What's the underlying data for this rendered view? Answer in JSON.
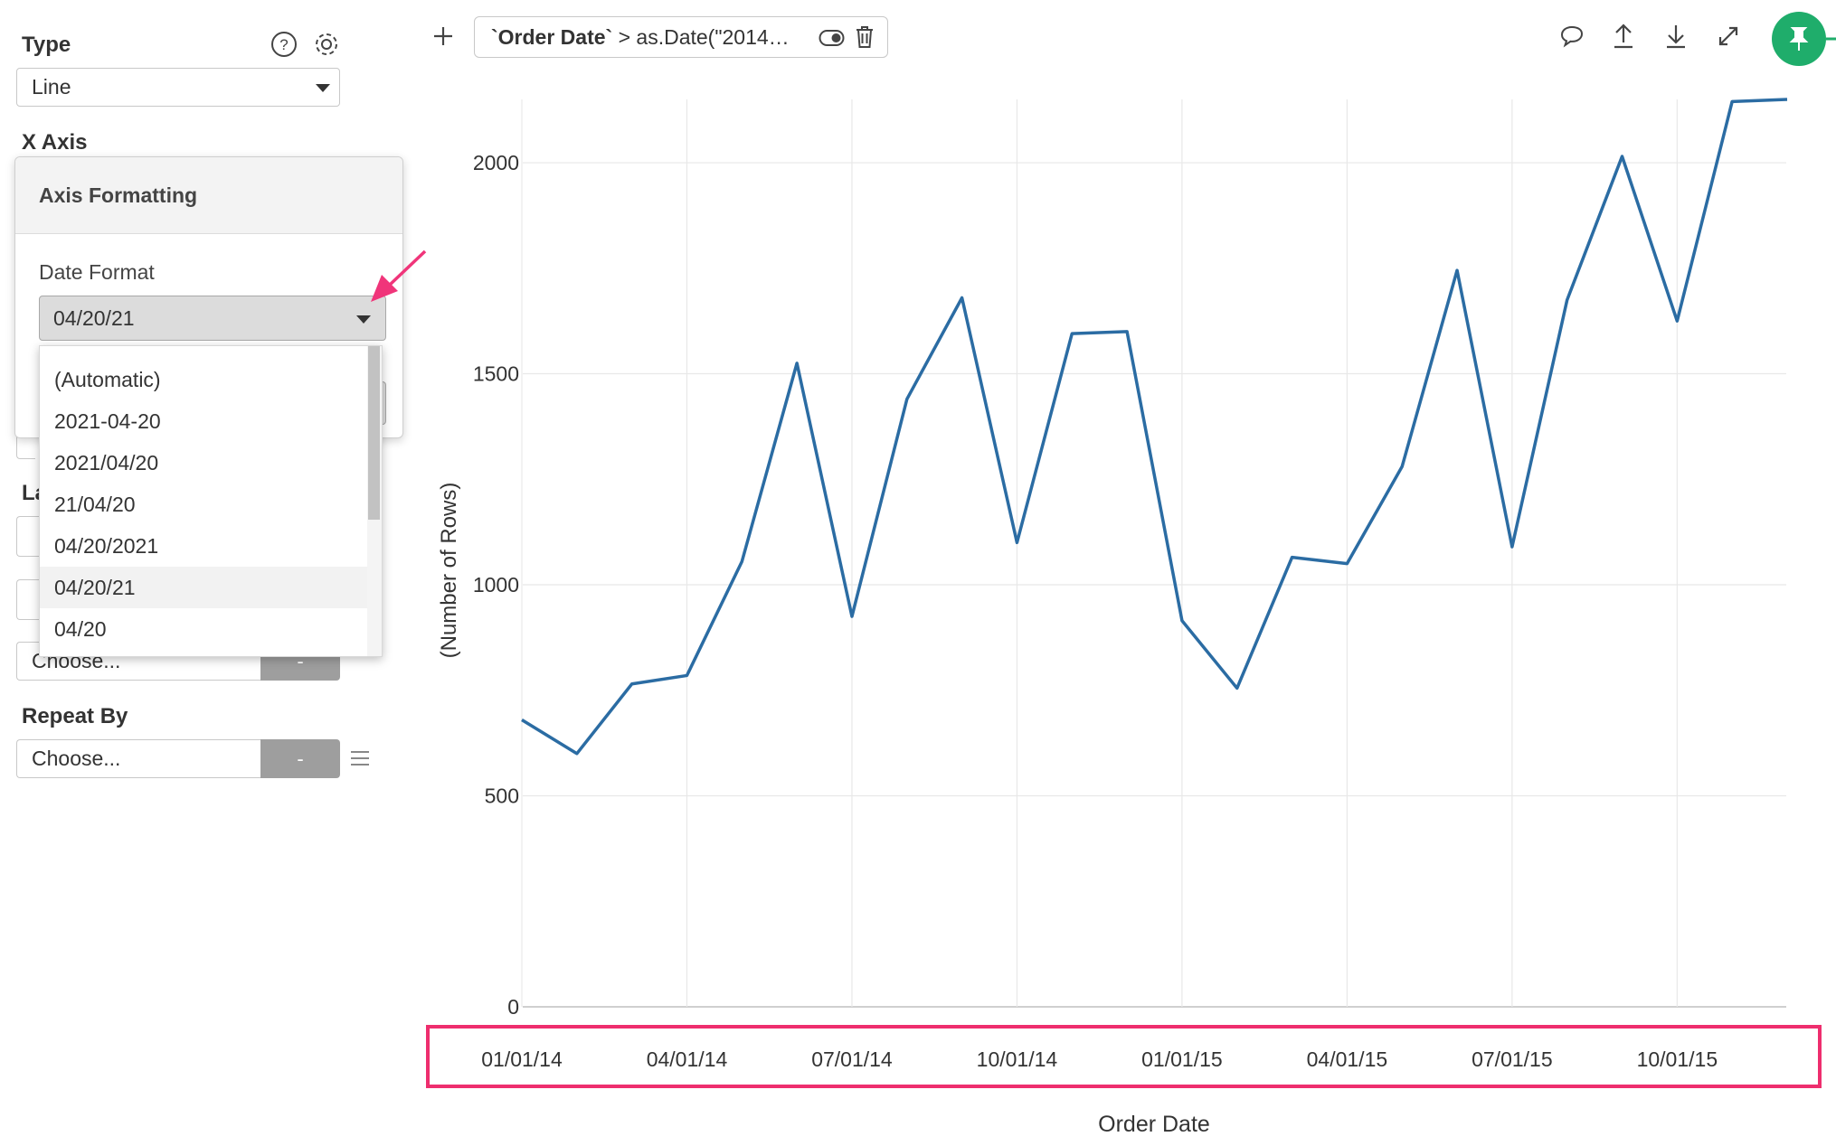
{
  "left_panel": {
    "type_label": "Type",
    "type_value": "Line",
    "x_axis_label": "X Axis",
    "partial_label": "La",
    "choose_placeholder": "Choose...",
    "choose_button": "-",
    "repeat_by_label": "Repeat By",
    "repeat_by_placeholder": "Choose...",
    "repeat_by_button": "-"
  },
  "axis_formatting": {
    "title": "Axis Formatting",
    "date_format_label": "Date Format",
    "date_format_value": "04/20/21",
    "options": [
      "(Automatic)",
      "2021-04-20",
      "2021/04/20",
      "21/04/20",
      "04/20/2021",
      "04/20/21",
      "04/20"
    ],
    "selected_index": 5
  },
  "toolbar": {
    "add_symbol": "+",
    "filter_field": "`Order Date`",
    "filter_rest": " > as.Date(\"2014…"
  },
  "icons": [
    "help-icon",
    "gear-icon",
    "add-icon",
    "toggle-icon",
    "trash-icon",
    "comment-icon",
    "upload-icon",
    "download-icon",
    "expand-icon",
    "pin-icon",
    "arrow-annotation-icon"
  ],
  "colors": {
    "line": "#2b6ca3",
    "highlight": "#ee2e6e",
    "pin": "#1fad6b",
    "arrow": "#f0357a"
  },
  "chart_data": {
    "type": "line",
    "xlabel": "Order Date",
    "ylabel": "(Number of Rows)",
    "ylim": [
      0,
      2150
    ],
    "yticks": [
      0,
      500,
      1000,
      1500,
      2000
    ],
    "xticks": [
      "01/01/14",
      "04/01/14",
      "07/01/14",
      "10/01/14",
      "01/01/15",
      "04/01/15",
      "07/01/15",
      "10/01/15"
    ],
    "x": [
      "2014-01",
      "2014-02",
      "2014-03",
      "2014-04",
      "2014-05",
      "2014-06",
      "2014-07",
      "2014-08",
      "2014-09",
      "2014-10",
      "2014-11",
      "2014-12",
      "2015-01",
      "2015-02",
      "2015-03",
      "2015-04",
      "2015-05",
      "2015-06",
      "2015-07",
      "2015-08",
      "2015-09",
      "2015-10",
      "2015-11",
      "2015-12"
    ],
    "values": [
      680,
      600,
      765,
      785,
      1055,
      1525,
      925,
      1440,
      1680,
      1100,
      1595,
      1600,
      915,
      755,
      1065,
      1050,
      1280,
      1745,
      1090,
      1675,
      2015,
      1625,
      2145,
      2150
    ],
    "grid": true
  }
}
